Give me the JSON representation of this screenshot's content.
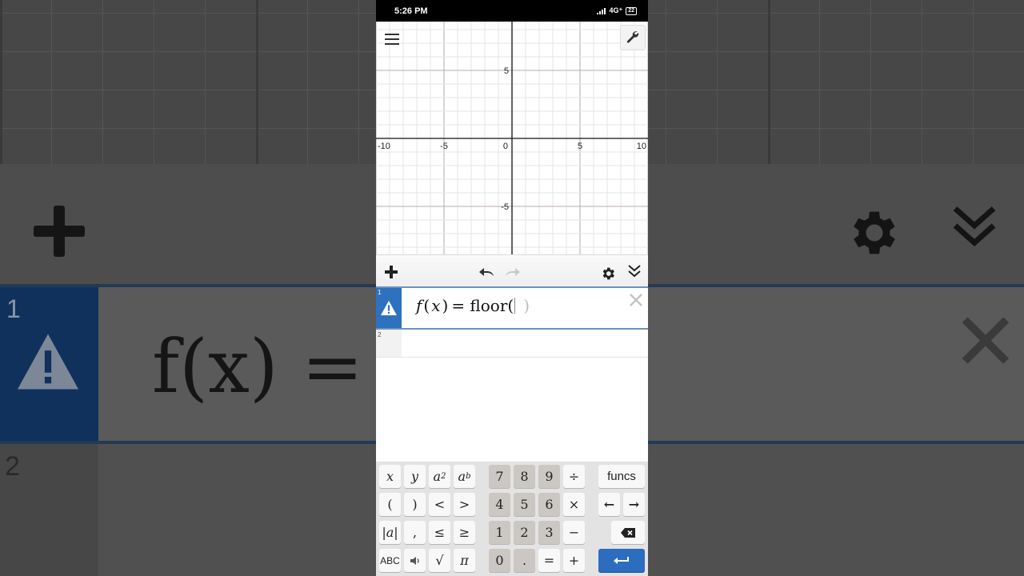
{
  "status_bar": {
    "time": "5:26 PM",
    "network": "4G⁺",
    "battery": "22"
  },
  "graph": {
    "x_tick_labels": [
      "-10",
      "-5",
      "0",
      "5",
      "10"
    ],
    "y_tick_labels": [
      "5",
      "-5"
    ],
    "x_range": [
      -10,
      10
    ],
    "y_range": [
      -8,
      8
    ]
  },
  "expression_list": {
    "expressions": [
      {
        "index": "1",
        "latex_display": {
          "f": "f",
          "x": "x",
          "rest": "= floor(",
          "ghost": ")",
          "open": "(",
          "close": ")"
        },
        "status": "warning"
      },
      {
        "index": "2",
        "latex_display": ""
      }
    ]
  },
  "background_zoom": {
    "index1": "1",
    "index2": "2",
    "formula": "f(x) = f"
  },
  "keypad": {
    "row1": [
      "x",
      "y",
      "a²",
      "aᵇ",
      "7",
      "8",
      "9",
      "÷",
      "funcs"
    ],
    "row2": [
      "(",
      ")",
      "<",
      ">",
      "4",
      "5",
      "6",
      "×",
      "←",
      "→"
    ],
    "row3": [
      "|a|",
      ",",
      "≤",
      "≥",
      "1",
      "2",
      "3",
      "−",
      "⌫"
    ],
    "row4": [
      "ABC",
      "🔈",
      "√",
      "π",
      "0",
      ".",
      "=",
      "+",
      "↵"
    ]
  },
  "colors": {
    "accent": "#2e71be",
    "grid_axis": "#000000",
    "key_dark": "#cbc7c3",
    "warning_tab": "#2e71be"
  }
}
